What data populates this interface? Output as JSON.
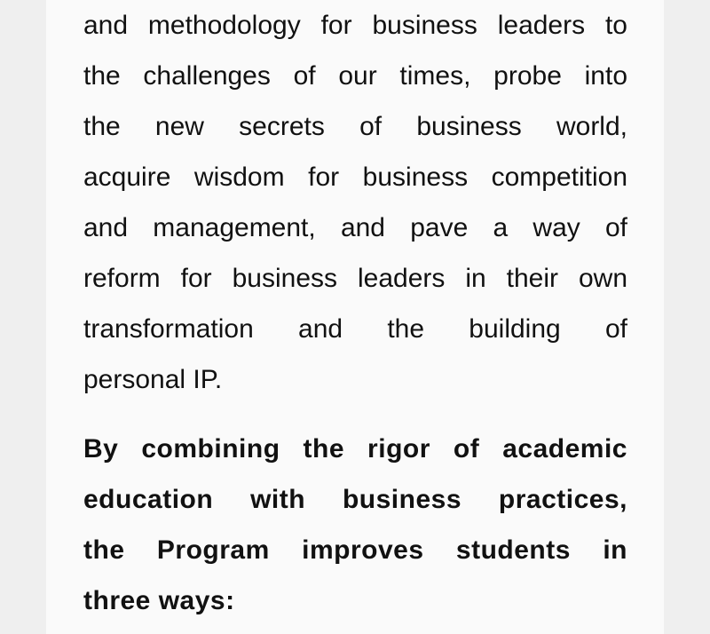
{
  "paragraph1": {
    "lines": [
      "and methodology for business leaders to",
      "the challenges of our times, probe into",
      "the new secrets of business world,",
      "acquire wisdom for business competition",
      "and management, and pave a way of",
      "reform for business leaders in their own",
      "transformation and the building of",
      "personal IP."
    ]
  },
  "paragraph2": {
    "lines": [
      "By combining the rigor of academic",
      "education with business practices,",
      "the Program improves students in",
      "three ways:"
    ]
  }
}
